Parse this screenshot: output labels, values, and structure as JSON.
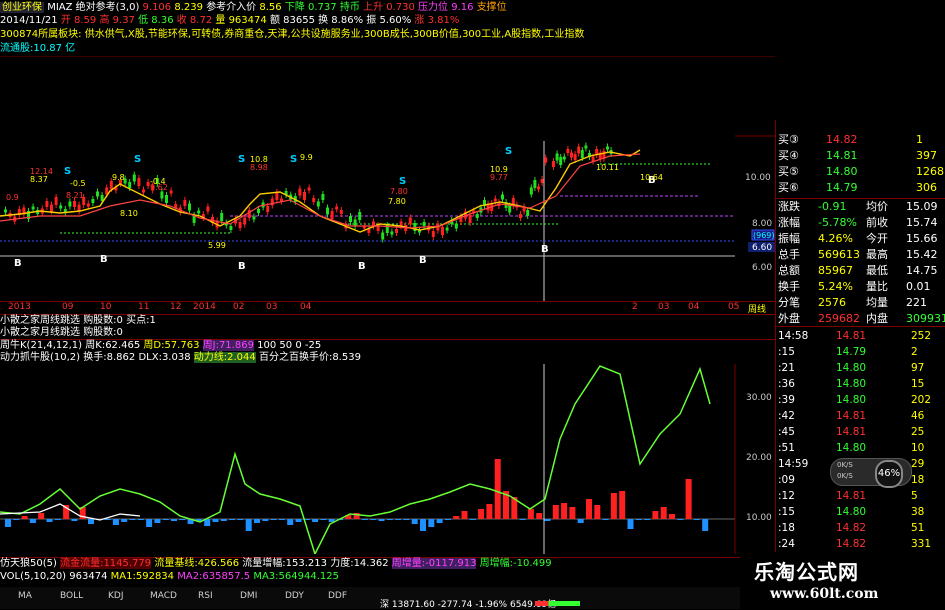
{
  "header": {
    "row1": {
      "title": "创业环保",
      "indicator": "MIAZ 绝对参考(3,0)",
      "v1": "9.106",
      "v2": "8.239",
      "ref_label": "参考介入价",
      "ref_value": "8.56",
      "down_label": "下降",
      "down_value": "0.737",
      "sell_label": "持币",
      "up_label": "上升",
      "up_value": "0.730",
      "resist_label": "压力位",
      "resist_value": "9.16",
      "support_label": "支撑位"
    },
    "row2": {
      "date": "2014/11/21",
      "open": "开 8.59",
      "high": "高 9.37",
      "low": "低 8.36",
      "close": "收 8.72",
      "volume": "量 963474",
      "amount": "额 83655",
      "turnover": "换 8.86%",
      "amplitude": "振 5.60%",
      "change": "涨 3.81%"
    },
    "concepts": "300874所属板块: 供水供气,X股,节能环保,可转债,券商重仓,天津,公共设施服务业,300B成长,300B价值,300工业,A股指数,工业指数",
    "float_cap": "流通股:10.87 亿"
  },
  "main_chart": {
    "price_labels": [
      "10.00",
      "8.00",
      "6.60",
      "6.00"
    ],
    "label_box": "(969)",
    "annotations": {
      "s_marks": [
        "S",
        "S",
        "S",
        "S",
        "S",
        "S"
      ],
      "b_marks": [
        "B",
        "B",
        "B",
        "B",
        "B",
        "B",
        "B"
      ],
      "values": [
        "12.14",
        "8.37",
        "-0.5",
        "8.21",
        "9.8",
        "-0.4",
        "9.62",
        "8.10",
        "10.8",
        "8.98",
        "7.80",
        "10.9",
        "9.77",
        "5.99",
        "9.9",
        "7.80",
        "10.11",
        "10.64",
        "0.9"
      ]
    },
    "x_ticks": [
      "2013",
      "09",
      "10",
      "11",
      "12",
      "2014",
      "02",
      "03",
      "04",
      "2",
      "03",
      "04",
      "05",
      "周线"
    ]
  },
  "indicators": {
    "line1": {
      "label": "小散之家周线跳选",
      "k1": "购股数:0",
      "k2": "买点:1"
    },
    "line2": {
      "label": "小散之家月线跳选",
      "k1": "购股数:0"
    },
    "line3": {
      "label": "周牛K(21,4,12,1)",
      "a": "周K:62.465",
      "b": "周D:57.763",
      "c": "周J:71.869",
      "d": "100",
      "e": "50",
      "f": "0",
      "g": "-25"
    },
    "line4": {
      "label": "动力抓牛股(10,2)",
      "a": "换手:8.862",
      "b": "DLX:3.038",
      "c": "动力线:2.044",
      "d": "百分之百换手价:8.539"
    },
    "right_ticks": [
      "30.00",
      "20.00",
      "10.00"
    ]
  },
  "bottom_info": {
    "line1": {
      "label": "仿天狼50(5)",
      "a": "流金流量:1145.779",
      "b": "流量基线:426.566",
      "c": "流量增幅:153.213",
      "d": "力度:14.362",
      "e": "周增量:-0117.913",
      "f": "周增幅:-10.499"
    },
    "line2": {
      "label": "VOL(5,10,20)",
      "a": "963474",
      "b": "MA1:592834",
      "c": "MA2:635857.5",
      "d": "MA3:564944.125"
    }
  },
  "tabs": [
    "MA",
    "BOLL",
    "KDJ",
    "MACD",
    "RSI",
    "DMI",
    "DDY",
    "DDF"
  ],
  "quote": {
    "bids": [
      {
        "label": "买③",
        "price": "14.82",
        "vol": "1"
      },
      {
        "label": "买④",
        "price": "14.81",
        "vol": "397"
      },
      {
        "label": "买⑤",
        "price": "14.80",
        "vol": "1268"
      },
      {
        "label": "买⑥",
        "price": "14.79",
        "vol": "306"
      }
    ],
    "stats": [
      {
        "l1": "涨跌",
        "v1": "-0.91",
        "l2": "均价",
        "v2": "15.09"
      },
      {
        "l1": "涨幅",
        "v1": "-5.78%",
        "l2": "前收",
        "v2": "15.74"
      },
      {
        "l1": "振幅",
        "v1": "4.26%",
        "l2": "今开",
        "v2": "15.66"
      },
      {
        "l1": "总手",
        "v1": "569613",
        "l2": "最高",
        "v2": "15.42"
      },
      {
        "l1": "总额",
        "v1": "85967",
        "l2": "最低",
        "v2": "14.75"
      },
      {
        "l1": "换手",
        "v1": "5.24%",
        "l2": "量比",
        "v2": "0.01"
      },
      {
        "l1": "分笔",
        "v1": "2576",
        "l2": "均量",
        "v2": "221"
      },
      {
        "l1": "外盘",
        "v1": "259682",
        "l2": "内盘",
        "v2": "309931"
      }
    ],
    "ticks": [
      {
        "t": "14:58",
        "p": "14.81",
        "v": "252"
      },
      {
        "t": ":15",
        "p": "14.79",
        "v": "2"
      },
      {
        "t": ":21",
        "p": "14.80",
        "v": "97"
      },
      {
        "t": ":36",
        "p": "14.80",
        "v": "15"
      },
      {
        "t": ":39",
        "p": "14.80",
        "v": "202"
      },
      {
        "t": ":42",
        "p": "14.81",
        "v": "46"
      },
      {
        "t": ":45",
        "p": "14.81",
        "v": "25"
      },
      {
        "t": ":51",
        "p": "14.80",
        "v": "10"
      },
      {
        "t": "14:59",
        "p": "14.81",
        "v": "29"
      },
      {
        "t": ":09",
        "p": "14.81",
        "v": "18"
      },
      {
        "t": ":12",
        "p": "14.81",
        "v": "5"
      },
      {
        "t": ":15",
        "p": "14.80",
        "v": "38"
      },
      {
        "t": ":18",
        "p": "14.82",
        "v": "51"
      },
      {
        "t": ":24",
        "p": "14.82",
        "v": "331"
      },
      {
        "t": ":30",
        "p": "14.82",
        "v": "13"
      },
      {
        "t": ":34",
        "p": "14.83",
        "v": "4"
      }
    ],
    "gauge": "46%",
    "gauge_rates": [
      "0K/S",
      "0K/S"
    ]
  },
  "index_bar": "深 13871.60 -277.74 -1.96% 6549.69亿",
  "watermark": {
    "title": "乐淘公式网",
    "url": "www.60lt.com"
  },
  "colors": {
    "up": "#ff3030",
    "down": "#33ff33",
    "background": "#000000",
    "frame": "#7a0000"
  }
}
